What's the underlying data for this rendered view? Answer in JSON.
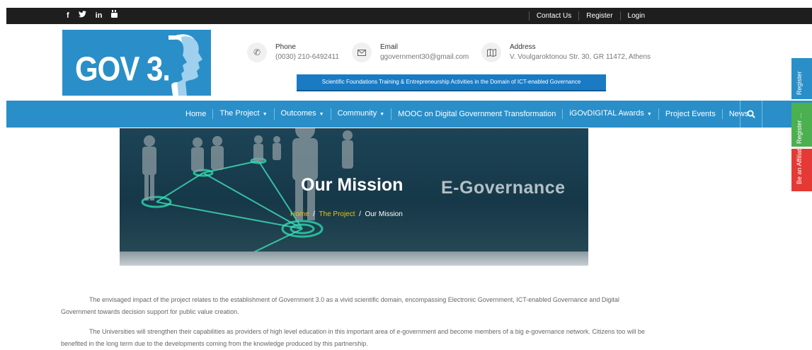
{
  "topbar": {
    "social_icons": [
      "facebook-icon",
      "twitter-icon",
      "linkedin-icon",
      "youtube-icon"
    ],
    "social_glyphs": [
      "f",
      "🐦",
      "in",
      "▶"
    ],
    "links": [
      "Contact Us",
      "Register",
      "Login"
    ]
  },
  "logo": {
    "text": "GOV 3.0"
  },
  "contact": {
    "phone": {
      "label": "Phone",
      "value": "(0030) 210-6492411"
    },
    "email": {
      "label": "Email",
      "value": "ggovernment30@gmail.com"
    },
    "address": {
      "label": "Address",
      "value": "V. Voulgaroktonou Str. 30, GR 11472, Athens"
    }
  },
  "tagline": "Scientific Foundations Training & Entrepreneurship Activities in the Domain of ICT-enabled Governance",
  "nav": {
    "items": [
      "Home",
      "The Project",
      "Outcomes",
      "Community",
      "MOOC on Digital Government Transformation",
      "iGOvDIGITAL Awards",
      "Project Events",
      "News"
    ]
  },
  "hero": {
    "title": "Our Mission",
    "image_text": "E-Governance",
    "breadcrumb": {
      "home": "Home",
      "project": "The Project",
      "current": "Our Mission"
    }
  },
  "body": {
    "p1": "The envisaged impact of the project relates to the establishment of Government 3.0 as a vivid scientific domain, encompassing Electronic Government, ICT-enabled Governance and Digital Government towards decision support for public value creation.",
    "p2": "The Universities will strengthen their capabilities as providers of high level education in this important area of e-government and become members of a big e-governance network. Citizens too will be benefited in the long term due to the developments coming from the knowledge produced by this partnership."
  },
  "side_tabs": {
    "register": "Register",
    "register_event": "Register ...",
    "affiliate": "Be an Affiliat..."
  },
  "colors": {
    "brand_blue": "#2a8fc8",
    "topbar": "#1e1e1e",
    "tab_green": "#4caf50",
    "tab_red": "#e53935",
    "crumb_yellow": "#f0c400"
  }
}
